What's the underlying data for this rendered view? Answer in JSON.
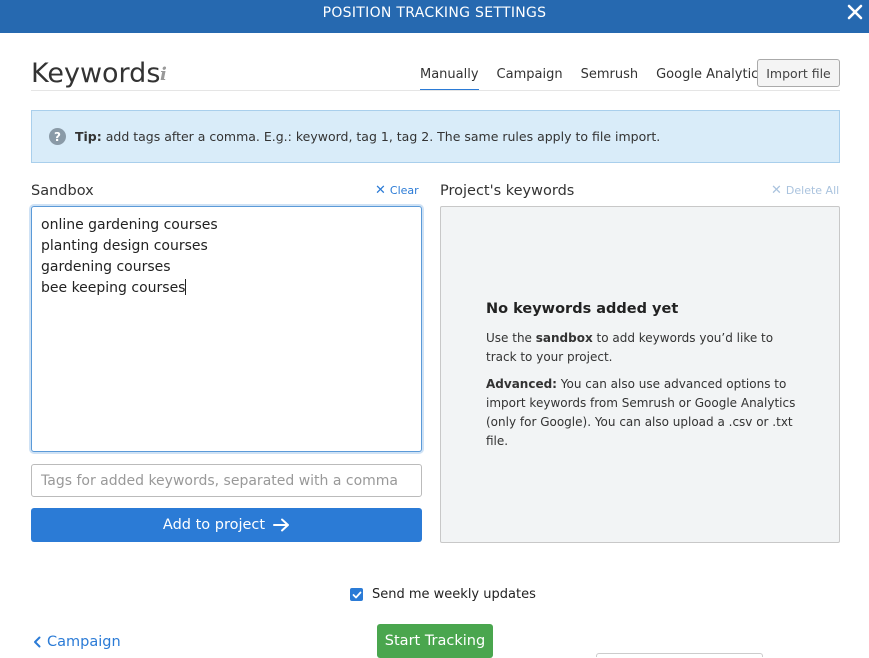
{
  "topbar": {
    "title": "POSITION TRACKING SETTINGS",
    "close_icon": "close-icon"
  },
  "heading": {
    "title": "Keywords",
    "info_glyph": "i"
  },
  "tabs": [
    {
      "label": "Manually",
      "active": true
    },
    {
      "label": "Campaign",
      "active": false
    },
    {
      "label": "Semrush",
      "active": false
    },
    {
      "label": "Google Analytics",
      "active": false
    }
  ],
  "import_button": {
    "label": "Import file"
  },
  "tip": {
    "icon_glyph": "?",
    "label": "Tip:",
    "text": " add tags after a comma. E.g.: keyword, tag 1, tag 2. The same rules apply to file import."
  },
  "sandbox": {
    "title": "Sandbox",
    "clear_label": "Clear",
    "lines": [
      "online gardening courses",
      "planting design courses",
      "gardening courses",
      "bee keeping courses"
    ]
  },
  "tags_input": {
    "placeholder": "Tags for added keywords, separated with a comma"
  },
  "add_button": {
    "label": "Add to project"
  },
  "project_keywords": {
    "title": "Project's keywords",
    "delete_all_label": "Delete All",
    "empty_title": "No keywords added yet",
    "p1_pre": "Use the ",
    "p1_bold": "sandbox",
    "p1_post": " to add keywords you’d like to track to your project.",
    "p2_bold": "Advanced:",
    "p2_post": " You can also use advanced options to import keywords from Semrush or Google Analytics (only for Google). You can also upload a .csv or .txt file."
  },
  "weekly": {
    "label": "Send me weekly updates",
    "checked": true
  },
  "back_link": {
    "label": "Campaign"
  },
  "start_button": {
    "label": "Start Tracking"
  },
  "colors": {
    "primary": "#2b7bd6",
    "header": "#2669b0",
    "success": "#4aa64e",
    "tip_bg": "#d9ecf9"
  }
}
